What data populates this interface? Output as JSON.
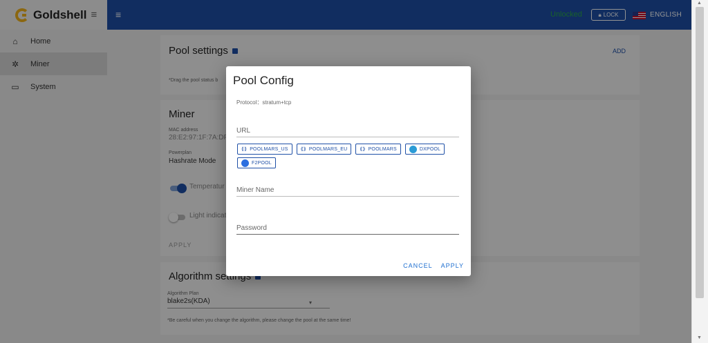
{
  "header": {
    "brand": "Goldshell",
    "status": "Unlocked",
    "lock_label": "LOCK",
    "language": "ENGLISH"
  },
  "sidebar": {
    "items": [
      {
        "label": "Home",
        "icon": "home-icon"
      },
      {
        "label": "Miner",
        "icon": "gear-icon",
        "active": true
      },
      {
        "label": "System",
        "icon": "monitor-icon"
      }
    ]
  },
  "pool_settings": {
    "title": "Pool settings",
    "add_label": "ADD",
    "hint": "*Drag the pool status b"
  },
  "miner": {
    "title": "Miner",
    "mac_label": "MAC address",
    "mac_value": "28:E2:97:1F:7A:DF",
    "powerplan_label": "Powerplan",
    "powerplan_value": "Hashrate Mode",
    "temperature_label": "Temperatur",
    "light_label": "Light indicat",
    "apply_label": "APPLY"
  },
  "algorithm": {
    "title": "Algorithm settings",
    "plan_label": "Algorithm Plan",
    "plan_value": "blake2s(KDA)",
    "warning": "*Be careful when you change the algorithm, please change the pool at the same time!"
  },
  "modal": {
    "title": "Pool Config",
    "protocol": "Protocol：stratum+tcp",
    "url_placeholder": "URL",
    "miner_name_placeholder": "Miner Name",
    "password_placeholder": "Password",
    "pools": [
      {
        "label": "POOLMARS_US",
        "icon": "poolmars-icon"
      },
      {
        "label": "POOLMARS_EU",
        "icon": "poolmars-icon"
      },
      {
        "label": "POOLMARS",
        "icon": "poolmars-icon"
      },
      {
        "label": "DXPOOL",
        "icon": "dxpool-icon"
      },
      {
        "label": "F2POOL",
        "icon": "f2pool-icon"
      }
    ],
    "cancel_label": "CANCEL",
    "apply_label": "APPLY"
  },
  "colors": {
    "primary": "#1e4fa6",
    "unlocked": "#2aa84a",
    "brand": "#f0b21c",
    "action": "#1e6fd0"
  }
}
